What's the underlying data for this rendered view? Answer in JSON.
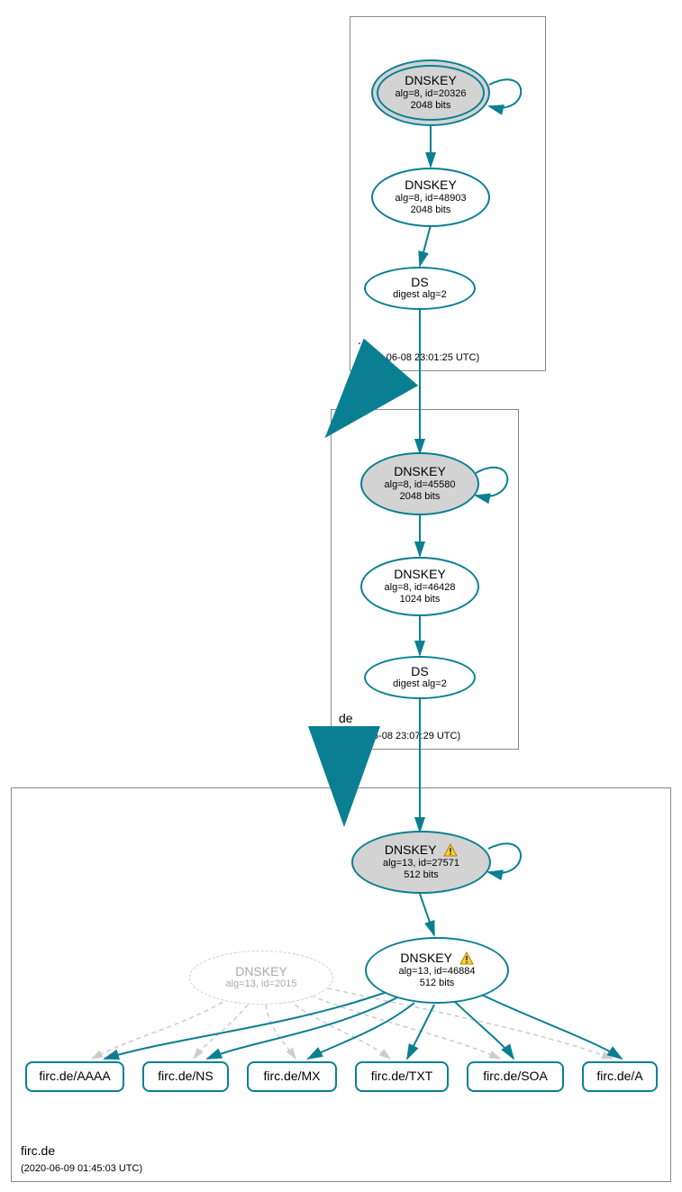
{
  "zones": {
    "root": {
      "name": ".",
      "ts": "(2020-06-08 23:01:25 UTC)"
    },
    "de": {
      "name": "de",
      "ts": "(2020-06-08 23:07:29 UTC)"
    },
    "firc": {
      "name": "firc.de",
      "ts": "(2020-06-09 01:45:03 UTC)"
    }
  },
  "nodes": {
    "rootKSK": {
      "t": "DNSKEY",
      "l1": "alg=8, id=20326",
      "l2": "2048 bits"
    },
    "rootZSK": {
      "t": "DNSKEY",
      "l1": "alg=8, id=48903",
      "l2": "2048 bits"
    },
    "rootDS": {
      "t": "DS",
      "l1": "digest alg=2"
    },
    "deKSK": {
      "t": "DNSKEY",
      "l1": "alg=8, id=45580",
      "l2": "2048 bits"
    },
    "deZSK": {
      "t": "DNSKEY",
      "l1": "alg=8, id=46428",
      "l2": "1024 bits"
    },
    "deDS": {
      "t": "DS",
      "l1": "digest alg=2"
    },
    "fircKSK": {
      "t": "DNSKEY",
      "l1": "alg=13, id=27571",
      "l2": "512 bits",
      "warn": true
    },
    "fircZSK": {
      "t": "DNSKEY",
      "l1": "alg=13, id=46884",
      "l2": "512 bits",
      "warn": true
    },
    "fircGhost": {
      "t": "DNSKEY",
      "l1": "alg=13, id=2015"
    },
    "rrAAAA": {
      "t": "firc.de/AAAA"
    },
    "rrNS": {
      "t": "firc.de/NS"
    },
    "rrMX": {
      "t": "firc.de/MX"
    },
    "rrTXT": {
      "t": "firc.de/TXT"
    },
    "rrSOA": {
      "t": "firc.de/SOA"
    },
    "rrA": {
      "t": "firc.de/A"
    }
  },
  "colors": {
    "teal": "#0a7f92",
    "gray": "#cccccc"
  }
}
